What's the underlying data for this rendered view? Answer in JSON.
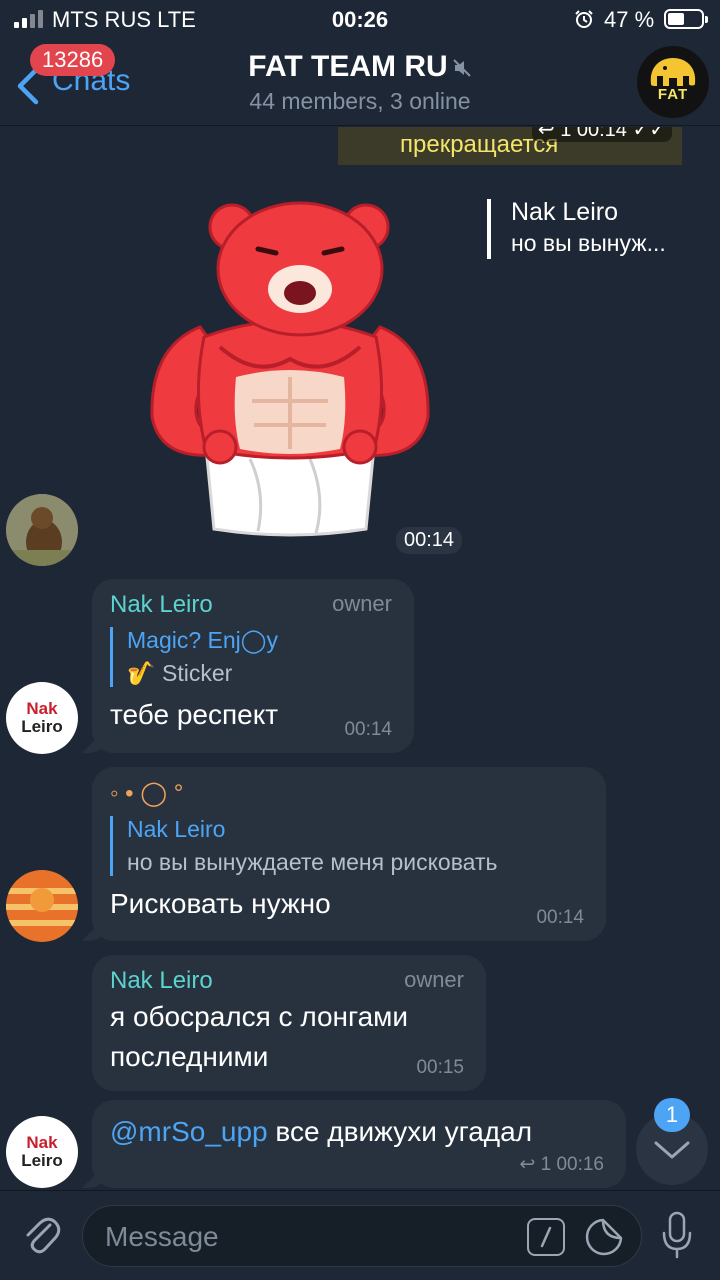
{
  "status": {
    "carrier": "MTS RUS  LTE",
    "time": "00:26",
    "battery": "47 %",
    "battery_level": 0.47
  },
  "header": {
    "back_label": "Chats",
    "unread_count": "13286",
    "title": "FAT TEAM RU",
    "subtitle": "44 members, 3 online",
    "avatar_label": "FAT"
  },
  "top_media": {
    "caption": "прекращается",
    "meta": "1  00:14"
  },
  "sticker_message": {
    "reply_name": "Nak Leiro",
    "reply_text": "но вы вынуж...",
    "time": "00:14"
  },
  "messages": [
    {
      "sender": "Nak Leiro",
      "role": "owner",
      "reply_name": "Magic? Enj◯y",
      "reply_text": "🎷 Sticker",
      "text": "тебе респект",
      "time": "00:14"
    },
    {
      "sender": "◦ • ◯ °",
      "reply_name": "Nak Leiro",
      "reply_text": "но вы вынуждаете меня рисковать",
      "text": "Рисковать нужно",
      "time": "00:14"
    },
    {
      "sender": "Nak Leiro",
      "role": "owner",
      "text_line1": "я обосрался с лонгами",
      "text_line2": "последними",
      "time": "00:15"
    },
    {
      "mention": "@mrSo_upp",
      "text": " все движухи угадал",
      "meta": "1  00:16"
    }
  ],
  "avatars": {
    "nak_line1": "Nak",
    "nak_line2": "Leiro"
  },
  "scroll": {
    "badge": "1"
  },
  "input": {
    "placeholder": "Message"
  },
  "colors": {
    "background": "#1e2735",
    "bubble": "#28323f",
    "accent": "#4da4f5",
    "sender": "#5bd3cf",
    "badge": "#e2454e"
  }
}
